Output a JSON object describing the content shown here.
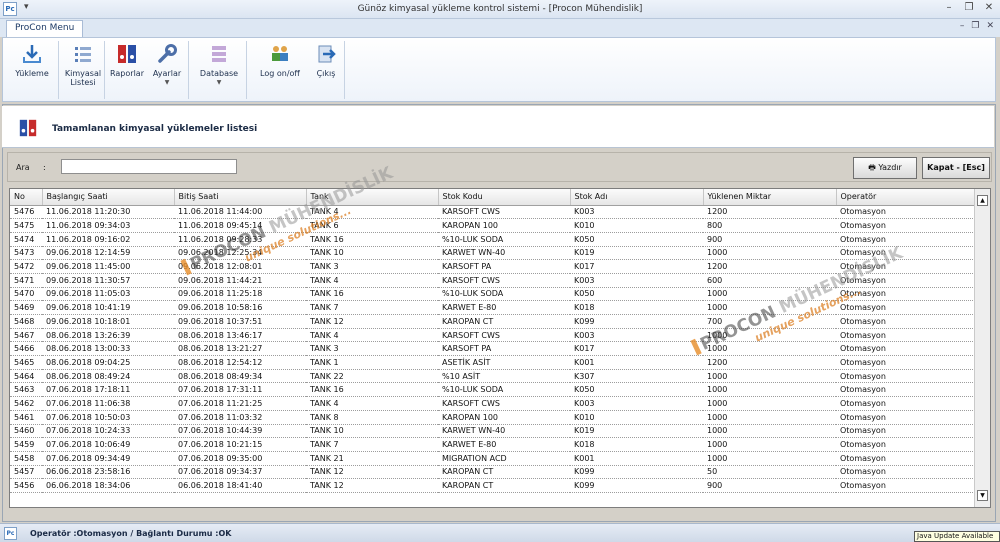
{
  "window": {
    "title": "Günöz kimyasal yükleme kontrol sistemi - [Procon Mühendislik]",
    "app_icon_text": "Pc",
    "quick_access": "▾"
  },
  "ribbon": {
    "tab": "ProCon Menu",
    "buttons": {
      "yukleme": "Yükleme",
      "kimyasal_listesi_1": "Kimyasal",
      "kimyasal_listesi_2": "Listesi",
      "raporlar": "Raporlar",
      "ayarlar": "Ayarlar",
      "database": "Database",
      "logonoff": "Log on/off",
      "cikis": "Çıkış"
    }
  },
  "panel": {
    "title": "Tamamlanan kimyasal yüklemeler listesi"
  },
  "search": {
    "label": "Ara",
    "colon": ":",
    "value": "",
    "print_button": "Yazdır",
    "close_button": "Kapat - [Esc]"
  },
  "grid": {
    "columns": [
      "No",
      "Başlangıç Saati",
      "Bitiş Saati",
      "Tank",
      "Stok Kodu",
      "Stok Adı",
      "Yüklenen Miktar",
      "Operatör"
    ],
    "rows": [
      [
        "5476",
        "11.06.2018 11:20:30",
        "11.06.2018 11:44:00",
        "TANK 4",
        "KARSOFT CWS",
        "K003",
        "1200",
        "Otomasyon"
      ],
      [
        "5475",
        "11.06.2018 09:34:03",
        "11.06.2018 09:45:14",
        "TANK 6",
        "KAROPAN 100",
        "K010",
        "800",
        "Otomasyon"
      ],
      [
        "5474",
        "11.06.2018 09:16:02",
        "11.06.2018 09:28:33",
        "TANK 16",
        "%10-LUK SODA",
        "K050",
        "900",
        "Otomasyon"
      ],
      [
        "5473",
        "09.06.2018 12:14:59",
        "09.06.2018 12:25:34",
        "TANK 10",
        "KARWET WN-40",
        "K019",
        "1000",
        "Otomasyon"
      ],
      [
        "5472",
        "09.06.2018 11:45:00",
        "09.06.2018 12:08:01",
        "TANK 3",
        "KARSOFT PA",
        "K017",
        "1200",
        "Otomasyon"
      ],
      [
        "5471",
        "09.06.2018 11:30:57",
        "09.06.2018 11:44:21",
        "TANK 4",
        "KARSOFT CWS",
        "K003",
        "600",
        "Otomasyon"
      ],
      [
        "5470",
        "09.06.2018 11:05:03",
        "09.06.2018 11:25:18",
        "TANK 16",
        "%10-LUK SODA",
        "K050",
        "1000",
        "Otomasyon"
      ],
      [
        "5469",
        "09.06.2018 10:41:19",
        "09.06.2018 10:58:16",
        "TANK 7",
        "KARWET E-80",
        "K018",
        "1000",
        "Otomasyon"
      ],
      [
        "5468",
        "09.06.2018 10:18:01",
        "09.06.2018 10:37:51",
        "TANK 12",
        "KAROPAN CT",
        "K099",
        "700",
        "Otomasyon"
      ],
      [
        "5467",
        "08.06.2018 13:26:39",
        "08.06.2018 13:46:17",
        "TANK 4",
        "KARSOFT CWS",
        "K003",
        "1000",
        "Otomasyon"
      ],
      [
        "5466",
        "08.06.2018 13:00:33",
        "08.06.2018 13:21:27",
        "TANK 3",
        "KARSOFT PA",
        "K017",
        "1000",
        "Otomasyon"
      ],
      [
        "5465",
        "08.06.2018 09:04:25",
        "08.06.2018 12:54:12",
        "TANK 1",
        "ASETİK ASİT",
        "K001",
        "1200",
        "Otomasyon"
      ],
      [
        "5464",
        "08.06.2018 08:49:24",
        "08.06.2018 08:49:34",
        "TANK 22",
        "%10 ASİT",
        "K307",
        "1000",
        "Otomasyon"
      ],
      [
        "5463",
        "07.06.2018 17:18:11",
        "07.06.2018 17:31:11",
        "TANK 16",
        "%10-LUK SODA",
        "K050",
        "1000",
        "Otomasyon"
      ],
      [
        "5462",
        "07.06.2018 11:06:38",
        "07.06.2018 11:21:25",
        "TANK 4",
        "KARSOFT CWS",
        "K003",
        "1000",
        "Otomasyon"
      ],
      [
        "5461",
        "07.06.2018 10:50:03",
        "07.06.2018 11:03:32",
        "TANK 8",
        "KAROPAN 100",
        "K010",
        "1000",
        "Otomasyon"
      ],
      [
        "5460",
        "07.06.2018 10:24:33",
        "07.06.2018 10:44:39",
        "TANK 10",
        "KARWET WN-40",
        "K019",
        "1000",
        "Otomasyon"
      ],
      [
        "5459",
        "07.06.2018 10:06:49",
        "07.06.2018 10:21:15",
        "TANK 7",
        "KARWET E-80",
        "K018",
        "1000",
        "Otomasyon"
      ],
      [
        "5458",
        "07.06.2018 09:34:49",
        "07.06.2018 09:35:00",
        "TANK 21",
        "MIGRATION ACD",
        "K001",
        "1000",
        "Otomasyon"
      ],
      [
        "5457",
        "06.06.2018 23:58:16",
        "07.06.2018 09:34:37",
        "TANK 12",
        "KAROPAN CT",
        "K099",
        "50",
        "Otomasyon"
      ],
      [
        "5456",
        "06.06.2018 18:34:06",
        "06.06.2018 18:41:40",
        "TANK 12",
        "KAROPAN CT",
        "K099",
        "900",
        "Otomasyon"
      ]
    ]
  },
  "watermark": {
    "brand_1": "PROCON",
    "brand_2": "MÜHENDİSLİK",
    "tagline": "unique solutions..."
  },
  "status": {
    "text": "Operatör :Otomasyon / Bağlantı Durumu :OK",
    "icon_text": "Pc",
    "java_tip": "Java Update Available"
  },
  "colors": {
    "accent_blue": "#2a6ab6",
    "ribbon_bg": "#eef3fa",
    "panel_bg": "#d4d0c8",
    "watermark_orange": "#e68c28"
  }
}
